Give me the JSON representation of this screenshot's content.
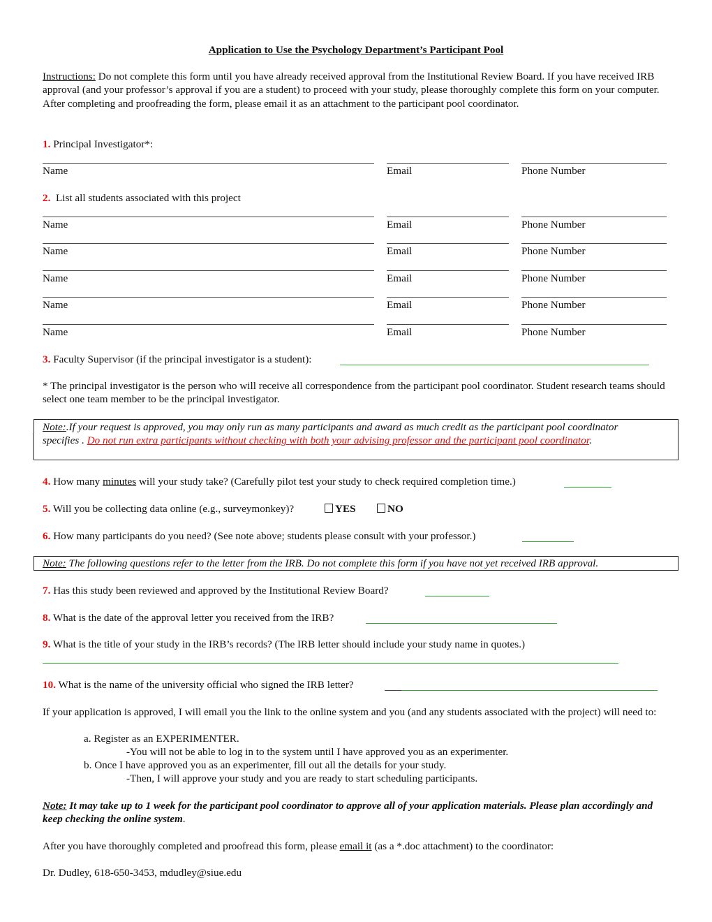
{
  "title": "Application to Use the Psychology Department’s Participant Pool",
  "instructions": {
    "label": "Instructions:",
    "text": " Do not complete this form until you have already received approval from the Institutional Review Board. If you have received IRB approval (and your professor’s approval if you are a student) to proceed with your study, please thoroughly complete this form on your computer. After completing and proofreading the form, please email it as an attachment to the participant pool coordinator."
  },
  "q1": {
    "number": "1.",
    "text": " Principal Investigator*:"
  },
  "q2": {
    "number": "2.",
    "text": "  List all students associated with this project"
  },
  "field_labels": {
    "name": "Name",
    "email": "Email",
    "phone": "Phone Number"
  },
  "q3": {
    "number": "3.",
    "text": " Faculty Supervisor (if the principal investigator is a student):"
  },
  "footnote": "* The principal investigator is the person who will receive all correspondence from the participant pool coordinator. Student research teams should select one team member to be the principal investigator.",
  "note1": {
    "label": "Note:",
    "text": ".If your request is approved, you may only run as many participants and award as much credit as the participant pool coordinator specifies . ",
    "warning": "Do not run extra participants without checking with both your advising professor and the participant pool coordinator",
    "end": "."
  },
  "q4": {
    "number": "4.",
    "pre": " How many ",
    "underlined": "minutes",
    "post": " will your study take? (Carefully pilot test your study to check required completion time.)"
  },
  "q5": {
    "number": "5.",
    "text": " Will you be collecting data online (e.g., surveymonkey)?",
    "options": [
      "YES",
      "NO"
    ]
  },
  "q6": {
    "number": "6.",
    "text": " How many participants do you need? (See note above; students please consult with your professor.)"
  },
  "note2": {
    "label": "Note:",
    "text": " The following questions refer to the letter from the IRB. Do not complete this form if you have not yet received IRB approval."
  },
  "q7": {
    "number": "7.",
    "text": " Has this study been reviewed and approved by the Institutional Review Board?"
  },
  "q8": {
    "number": "8.",
    "text": " What is the date of the approval letter you received from the IRB?"
  },
  "q9": {
    "number": "9.",
    "text": " What is the title of your study in the IRB’s records? (The IRB letter should include your study name in quotes.)"
  },
  "q10": {
    "number": "10.",
    "text": " What is the name of the university official who signed the IRB letter?"
  },
  "approval": {
    "intro": "If your application is approved, I will email you the link to the online system and you (and any students associated with the project) will need to:",
    "step_a": "a. Register as an EXPERIMENTER.",
    "step_a_sub": "-You will not be able to log in to the system until I have approved you as an experimenter.",
    "step_b": "b. Once I have approved you as an experimenter, fill out all the details for your study.",
    "step_b_sub": "-Then, I will approve your study and you are ready to start scheduling participants."
  },
  "note3": {
    "label": "Note:",
    "text": " It may take up to 1 week for the participant pool coordinator to approve all of your application materials. Please plan accordingly and keep checking the online system",
    "end": "."
  },
  "closing": {
    "pre": "After you have thoroughly completed and proofread this form, please ",
    "link": "email it",
    "post": " (as a *.doc attachment) to the coordinator:"
  },
  "contact": "Dr. Dudley, 618-650-3453, mdudley@siue.edu",
  "colors": {
    "number_red": "#e01010",
    "answer_line_green": "#3aa43a"
  }
}
